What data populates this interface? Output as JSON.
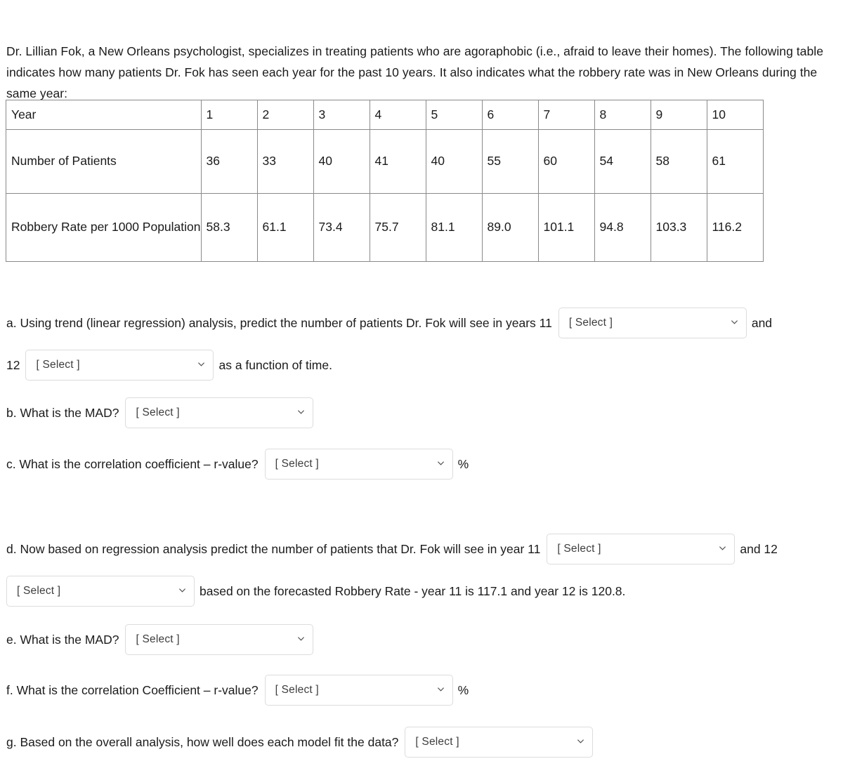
{
  "intro": {
    "paragraph": "Dr. Lillian Fok, a New Orleans psychologist, specializes in treating patients who are agoraphobic (i.e., afraid to leave their homes). The following table indicates how many patients Dr. Fok has seen each year for the past 10 years. It also indicates what the robbery rate was in New Orleans during the same year:"
  },
  "table": {
    "row_labels": [
      "Year",
      "Number of Patients",
      "Robbery Rate per 1000 Population"
    ],
    "years": [
      "1",
      "2",
      "3",
      "4",
      "5",
      "6",
      "7",
      "8",
      "9",
      "10"
    ],
    "patients": [
      "36",
      "33",
      "40",
      "41",
      "40",
      "55",
      "60",
      "54",
      "58",
      "61"
    ],
    "robbery_rate": [
      "58.3",
      "61.1",
      "73.4",
      "75.7",
      "81.1",
      "89.0",
      "101.1",
      "94.8",
      "103.3",
      "116.2"
    ]
  },
  "select_placeholder": "[ Select ]",
  "questions": {
    "a": {
      "text_before": "a. Using trend (linear regression) analysis, predict the number of patients Dr. Fok will see in years 11",
      "text_mid": "and",
      "text_line2_prefix": "12",
      "text_after": "as a function of time."
    },
    "b": {
      "text_before": "b. What is the MAD?"
    },
    "c": {
      "text_before": "c. What is the correlation coefficient – r-value?",
      "suffix": "%"
    },
    "d": {
      "text_before": "d. Now based on regression analysis predict the number of patients that Dr. Fok will see in year 11",
      "text_mid": "and 12",
      "text_after": "based on the forecasted Robbery Rate - year 11 is 117.1 and year 12 is 120.8."
    },
    "e": {
      "text_before": "e. What is the MAD?"
    },
    "f": {
      "text_before": "f.  What is the correlation Coefficient – r-value?",
      "suffix": "%"
    },
    "g": {
      "text_before": "g. Based on the overall analysis, how well does each model fit the data?"
    }
  },
  "colors": {
    "text": "#1b1b1b",
    "table_border": "#8a8a8a",
    "select_border": "#dcdcdc",
    "select_text": "#3d3d3d",
    "background": "#ffffff"
  }
}
